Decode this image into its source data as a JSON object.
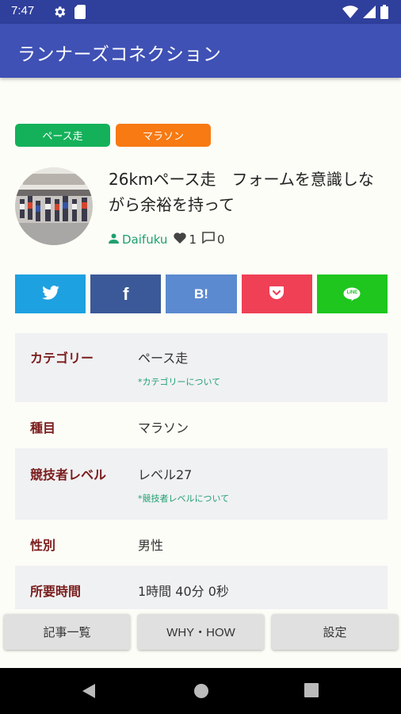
{
  "status_bar": {
    "time": "7:47",
    "left_icons": [
      "gear-icon",
      "sim-card-icon"
    ],
    "right_icons": [
      "wifi-icon",
      "signal-icon",
      "battery-icon"
    ]
  },
  "app_bar": {
    "title": "ランナーズコネクション"
  },
  "tags": [
    {
      "label": "ペース走",
      "color": "#14b15a"
    },
    {
      "label": "マラソン",
      "color": "#f77a12"
    }
  ],
  "article": {
    "title": "26kmペース走　フォームを意識しながら余裕を持って",
    "author": "Daifuku",
    "likes": "1",
    "comments": "0"
  },
  "share_buttons": [
    {
      "name": "twitter",
      "icon": "twitter-icon",
      "color": "#1ea1e0"
    },
    {
      "name": "facebook",
      "label": "f",
      "icon": "facebook-icon",
      "color": "#3b5998"
    },
    {
      "name": "hatena",
      "label": "B!",
      "icon": "hatena-bookmark-icon",
      "color": "#5c8ad0"
    },
    {
      "name": "pocket",
      "icon": "pocket-icon",
      "color": "#ef4056"
    },
    {
      "name": "line",
      "label": "LINE",
      "icon": "line-icon",
      "color": "#1ec61e"
    }
  ],
  "details": [
    {
      "label": "カテゴリー",
      "value": "ペース走",
      "link": "*カテゴリーについて"
    },
    {
      "label": "種目",
      "value": "マラソン"
    },
    {
      "label": "競技者レベル",
      "value": "レベル27",
      "link": "*競技者レベルについて"
    },
    {
      "label": "性別",
      "value": "男性"
    },
    {
      "label": "所要時間",
      "value": "1時間 40分 0秒"
    }
  ],
  "bottom_nav": [
    {
      "label": "記事一覧"
    },
    {
      "label": "WHY・HOW"
    },
    {
      "label": "設定"
    }
  ],
  "system_nav": [
    "back-icon",
    "home-icon",
    "recents-icon"
  ],
  "colors": {
    "primary": "#3f51b5",
    "primary_dark": "#2f3f9c",
    "label_red": "#7a1c1c",
    "link_green": "#20a070"
  }
}
